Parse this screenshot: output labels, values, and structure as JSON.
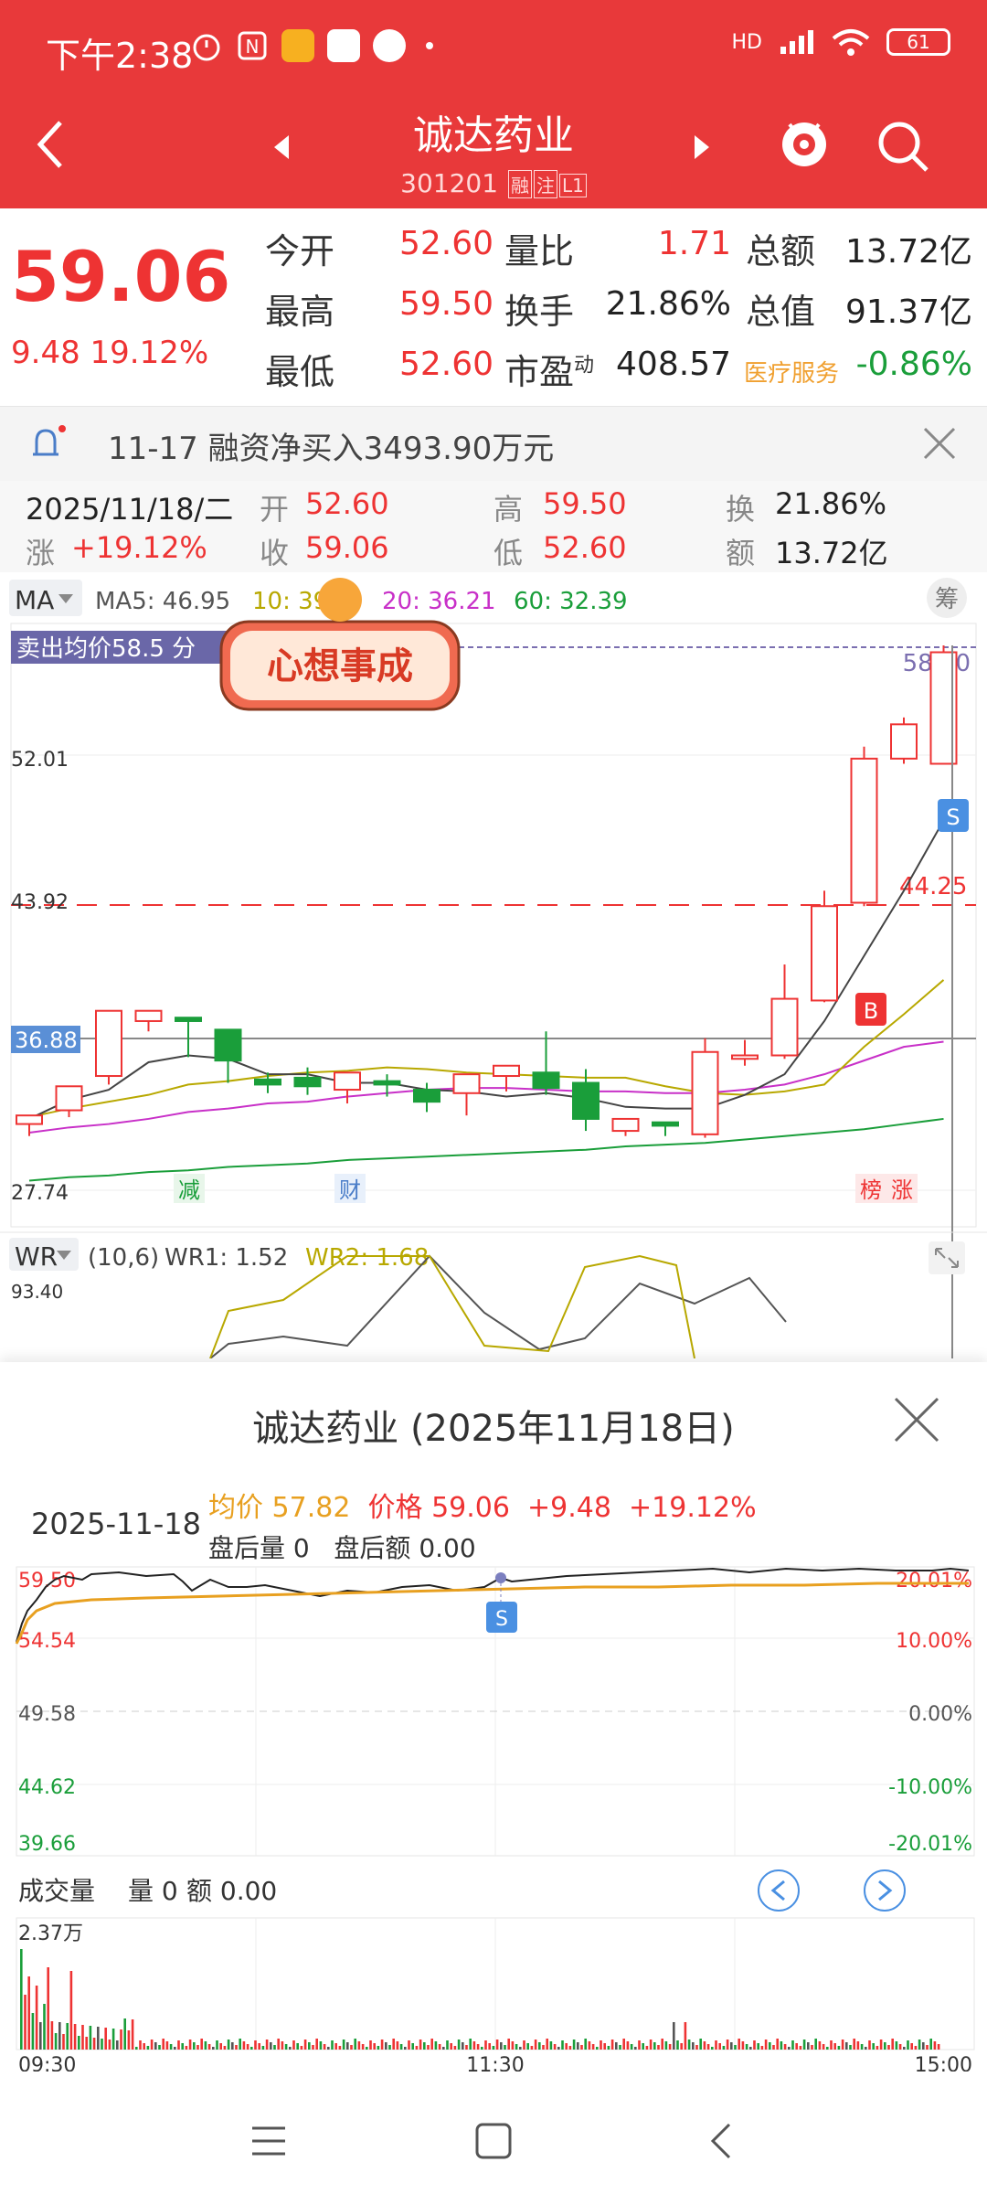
{
  "status_bar": {
    "time": "下午2:38",
    "network": "HD",
    "battery": "61"
  },
  "header": {
    "title": "诚达药业",
    "code": "301201",
    "tags": [
      "融",
      "注",
      "L1"
    ]
  },
  "quote": {
    "price": "59.06",
    "change": "9.48",
    "change_pct": "19.12%",
    "rows": [
      {
        "l1": "今开",
        "v1": "52.60",
        "l2": "量比",
        "v2": "1.71",
        "l3": "总额",
        "v3": "13.72亿"
      },
      {
        "l1": "最高",
        "v1": "59.50",
        "l2": "换手",
        "v2": "21.86%",
        "l3": "总值",
        "v3": "91.37亿"
      },
      {
        "l1": "最低",
        "v1": "52.60",
        "l2": "市盈",
        "l2_sup": "动",
        "v2": "408.57",
        "l3": "医疗服务",
        "v3": "-0.86%"
      }
    ]
  },
  "notice": {
    "text": "11-17 融资净买入3493.90万元"
  },
  "ohlc": {
    "date": "2025/11/18/二",
    "open_lbl": "开",
    "open": "52.60",
    "high_lbl": "高",
    "high": "59.50",
    "turnover_lbl": "换",
    "turnover": "21.86%",
    "chg_lbl": "涨",
    "chg": "+19.12%",
    "close_lbl": "收",
    "close": "59.06",
    "low_lbl": "低",
    "low": "52.60",
    "amount_lbl": "额",
    "amount": "13.72亿"
  },
  "kline": {
    "ma_label": "MA",
    "ma5": "MA5: 46.95",
    "ma10": "10: 39",
    "ma20": "20: 36.21",
    "ma60": "60: 32.39",
    "chip_btn": "筹",
    "sell_avg": "卖出均价58.5 分",
    "sticker": "心想事成",
    "price_labels": {
      "top": "58.50",
      "p52": "52.01",
      "p43": "43.92",
      "p36": "36.88",
      "p27": "27.74",
      "dash": "44.25"
    },
    "markers": {
      "b": "B",
      "s": "S"
    },
    "events": [
      "减",
      "财",
      "榜",
      "涨"
    ],
    "wr_label": "WR",
    "wr_params": "(10,6)",
    "wr1": "WR1: 1.52",
    "wr2": "WR2: 1.68",
    "wr_top": "93.40"
  },
  "kline_data": {
    "candles": [
      [
        31.6,
        32.1,
        30.9,
        31.4
      ],
      [
        32.4,
        33.8,
        32.0,
        33.3
      ],
      [
        34.4,
        38.2,
        33.9,
        38.0
      ],
      [
        37.6,
        38.2,
        37.0,
        37.7
      ],
      [
        37.8,
        37.6,
        35.8,
        35.5
      ],
      [
        37.1,
        35.3,
        34.3,
        34.0
      ],
      [
        34.2,
        33.9,
        34.6,
        33.4
      ],
      [
        34.3,
        33.8,
        34.9,
        33.3
      ],
      [
        33.6,
        34.6,
        32.8,
        33.2
      ],
      [
        34.1,
        33.9,
        34.5,
        33.2
      ],
      [
        33.6,
        32.9,
        34.0,
        32.3
      ],
      [
        33.4,
        34.5,
        33.0,
        32.1
      ],
      [
        34.4,
        35.0,
        33.9,
        33.5
      ],
      [
        34.6,
        33.7,
        37.0,
        33.3
      ],
      [
        34.0,
        31.9,
        34.8,
        31.2
      ],
      [
        31.2,
        31.9,
        31.1,
        30.9
      ],
      [
        31.7,
        31.5,
        30.9,
        31.0
      ],
      [
        31.0,
        35.8,
        30.8,
        36.6
      ],
      [
        35.4,
        35.6,
        36.5,
        35.0
      ],
      [
        35.6,
        38.9,
        35.4,
        40.9
      ],
      [
        38.8,
        44.3,
        38.7,
        45.2
      ],
      [
        44.5,
        52.9,
        44.3,
        53.6
      ],
      [
        52.9,
        54.9,
        52.6,
        55.3
      ],
      [
        52.6,
        59.1,
        52.6,
        59.5
      ]
    ],
    "ma5": [
      31.9,
      33.0,
      33.6,
      35.2,
      35.6,
      35.4,
      34.5,
      34.5,
      34.0,
      34.0,
      33.6,
      33.5,
      33.2,
      33.4,
      33.1,
      32.6,
      32.5,
      32.5,
      33.3,
      34.5,
      37.6,
      41.4,
      45.2,
      49.3
    ],
    "ma10": [
      32.0,
      32.5,
      32.9,
      33.3,
      33.9,
      34.1,
      34.4,
      34.6,
      34.7,
      34.9,
      34.8,
      34.6,
      34.5,
      34.4,
      34.3,
      34.3,
      33.8,
      33.4,
      33.3,
      33.5,
      33.9,
      36.1,
      38.0,
      40.0
    ],
    "ma20": [
      31.1,
      31.4,
      31.6,
      31.9,
      32.3,
      32.5,
      32.8,
      32.9,
      33.2,
      33.4,
      33.6,
      33.7,
      33.7,
      33.6,
      33.5,
      33.5,
      33.4,
      33.4,
      33.6,
      33.9,
      34.5,
      35.3,
      36.1,
      36.4
    ],
    "ma60": [
      28.3,
      28.5,
      28.6,
      28.8,
      28.9,
      29.1,
      29.2,
      29.3,
      29.5,
      29.6,
      29.7,
      29.8,
      29.9,
      30.0,
      30.1,
      30.3,
      30.4,
      30.5,
      30.7,
      30.9,
      31.1,
      31.3,
      31.6,
      31.9
    ]
  },
  "intraday": {
    "title": "诚达药业 (2025年11月18日)",
    "date": "2025-11-18",
    "avg_lbl": "均价",
    "avg": "57.82",
    "price_lbl": "价格",
    "price": "59.06",
    "chg": "+9.48",
    "chg_pct": "+19.12%",
    "after_vol": "盘后量 0",
    "after_amt": "盘后额 0.00",
    "y_left": [
      "59.50",
      "54.54",
      "49.58",
      "44.62",
      "39.66"
    ],
    "y_right": [
      "20.01%",
      "10.00%",
      "0.00%",
      "-10.00%",
      "-20.01%"
    ],
    "s_marker": "S",
    "vol_title": "成交量",
    "vol_amt": "量 0",
    "vol_money": "额 0.00",
    "vol_max": "2.37万",
    "time_labels": [
      "09:30",
      "11:30",
      "15:00"
    ]
  },
  "colors": {
    "brand_red": "#e8393a",
    "up": "#e33",
    "down": "#1a9e3a",
    "avg_line": "#e8a020"
  }
}
